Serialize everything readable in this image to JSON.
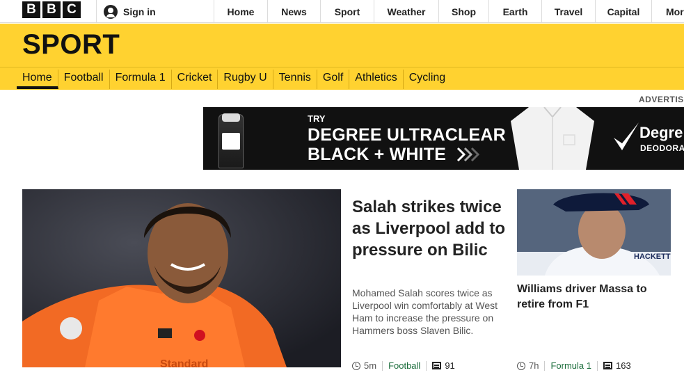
{
  "brand": {
    "letters": [
      "B",
      "B",
      "C"
    ]
  },
  "topbar": {
    "signin_label": "Sign in",
    "nav": [
      "Home",
      "News",
      "Sport",
      "Weather",
      "Shop",
      "Earth",
      "Travel",
      "Capital",
      "Mor"
    ]
  },
  "sport": {
    "title": "SPORT",
    "nav": [
      "Home",
      "Football",
      "Formula 1",
      "Cricket",
      "Rugby U",
      "Tennis",
      "Golf",
      "Athletics",
      "Cycling"
    ],
    "active_nav": "Home"
  },
  "advert": {
    "label": "ADVERTISE",
    "try": "TRY",
    "headline_1": "DEGREE ULTRACLEAR",
    "headline_2": "BLACK + WHITE",
    "brand": "Degre",
    "brand_sub": "DEODORA",
    "product_label": "Degree"
  },
  "lead_story": {
    "headline": "Salah strikes twice as Liverpool add to pressure on Bilic",
    "summary": "Mohamed Salah scores twice as Liverpool win comfortably at West Ham to increase the pressure on Hammers boss Slaven Bilic.",
    "time": "5m",
    "section": "Football",
    "comments": "91",
    "image_text": "Standard"
  },
  "side_story": {
    "headline": "Williams driver Massa to retire from F1",
    "time": "7h",
    "section": "Formula 1",
    "comments": "163",
    "image_text": "HACKETT"
  },
  "colors": {
    "sport_yellow": "#ffd230",
    "section_green": "#1b6d3b",
    "bbc_black": "#111111"
  }
}
